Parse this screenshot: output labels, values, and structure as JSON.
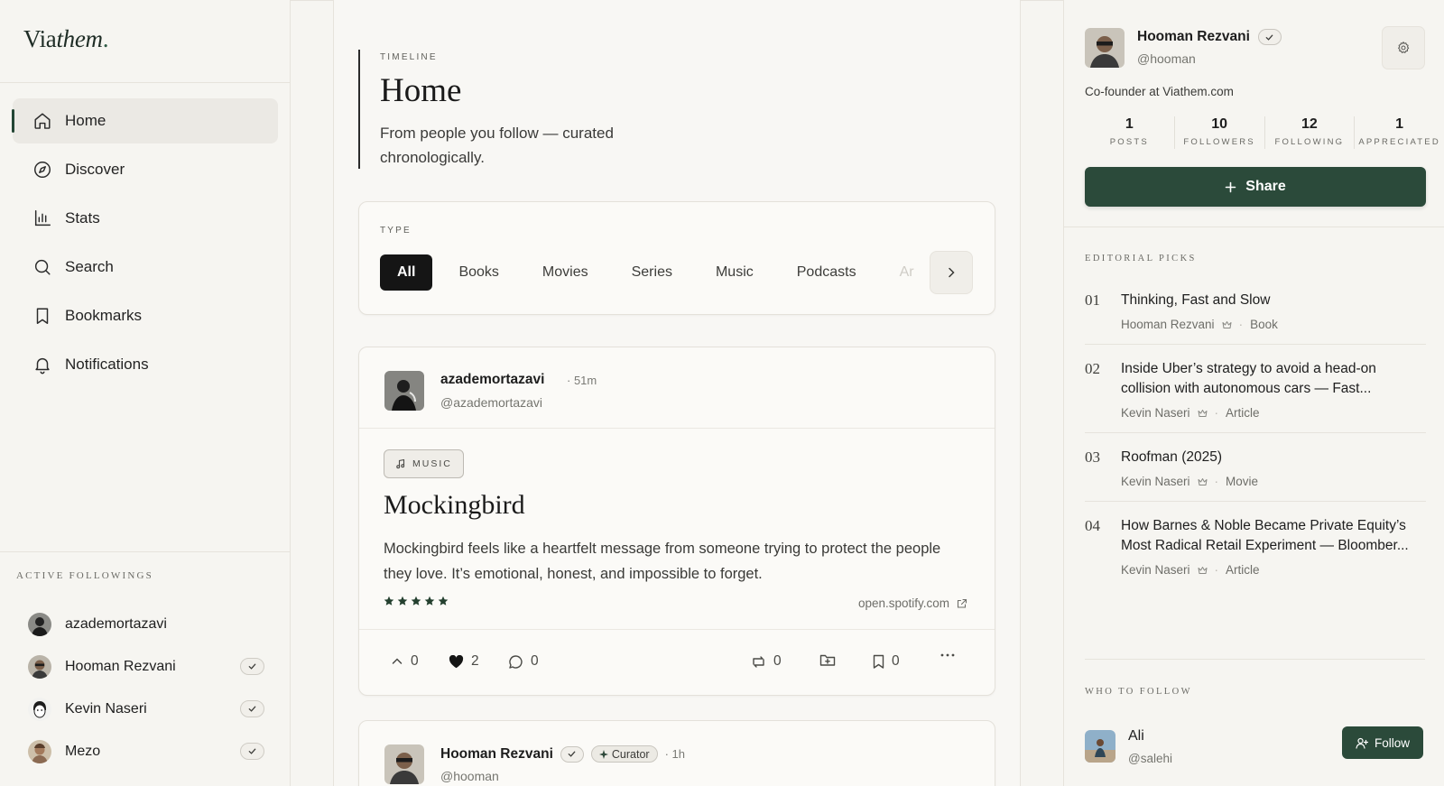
{
  "app": {
    "logo_main": "Via",
    "logo_italic": "them",
    "logo_dot": "."
  },
  "nav": {
    "items": [
      {
        "label": "Home",
        "icon": "home-icon",
        "active": true
      },
      {
        "label": "Discover",
        "icon": "compass-icon"
      },
      {
        "label": "Stats",
        "icon": "bar-chart-icon"
      },
      {
        "label": "Search",
        "icon": "search-icon"
      },
      {
        "label": "Bookmarks",
        "icon": "bookmark-icon"
      },
      {
        "label": "Notifications",
        "icon": "bell-icon"
      }
    ]
  },
  "active_followings": {
    "title": "ACTIVE FOLLOWINGS",
    "items": [
      {
        "name": "azademortazavi",
        "verified": false
      },
      {
        "name": "Hooman Rezvani",
        "verified": true
      },
      {
        "name": "Kevin Naseri",
        "verified": true
      },
      {
        "name": "Mezo",
        "verified": true
      }
    ]
  },
  "timeline": {
    "eyebrow": "TIMELINE",
    "title": "Home",
    "subtitle": "From people you follow — curated chronologically."
  },
  "type_filter": {
    "label": "TYPE",
    "chips": [
      "All",
      "Books",
      "Movies",
      "Series",
      "Music",
      "Podcasts",
      "Ar"
    ],
    "selected": "All"
  },
  "post": {
    "user": "azademortazavi",
    "time": "· 51m",
    "handle": "@azademortazavi",
    "category": "MUSIC",
    "title": "Mockingbird",
    "body": "Mockingbird feels like a heartfelt message from someone trying to protect the people they love. It’s emotional, honest, and impossible to forget.",
    "rating": 5,
    "link": "open.spotify.com",
    "actions": {
      "upvotes": "0",
      "likes": "2",
      "comments": "0",
      "reposts": "0",
      "bookmarks": "0"
    }
  },
  "post2": {
    "user": "Hooman Rezvani",
    "badge": "Curator",
    "time": "· 1h",
    "handle": "@hooman"
  },
  "profile": {
    "name": "Hooman Rezvani",
    "handle": "@hooman",
    "bio": "Co-founder at Viathem.com",
    "stats": [
      {
        "value": "1",
        "label": "POSTS"
      },
      {
        "value": "10",
        "label": "FOLLOWERS"
      },
      {
        "value": "12",
        "label": "FOLLOWING"
      },
      {
        "value": "1",
        "label": "APPRECIATED"
      }
    ],
    "share_label": "Share"
  },
  "editorial": {
    "title": "EDITORIAL PICKS",
    "items": [
      {
        "no": "01",
        "title": "Thinking, Fast and Slow",
        "author": "Hooman Rezvani",
        "type": "Book"
      },
      {
        "no": "02",
        "title": "Inside Uber’s strategy to avoid a head-on collision with autonomous cars — Fast...",
        "author": "Kevin Naseri",
        "type": "Article"
      },
      {
        "no": "03",
        "title": "Roofman (2025)",
        "author": "Kevin Naseri",
        "type": "Movie"
      },
      {
        "no": "04",
        "title": "How Barnes & Noble Became Private Equity’s Most Radical Retail Experiment — Bloomber...",
        "author": "Kevin Naseri",
        "type": "Article"
      }
    ]
  },
  "who_to_follow": {
    "title": "WHO TO FOLLOW",
    "name": "Ali",
    "handle": "@salehi",
    "button": "Follow"
  },
  "colors": {
    "accent": "#2b4a3a",
    "background": "#f6f5f1",
    "active_chip": "#151515"
  }
}
